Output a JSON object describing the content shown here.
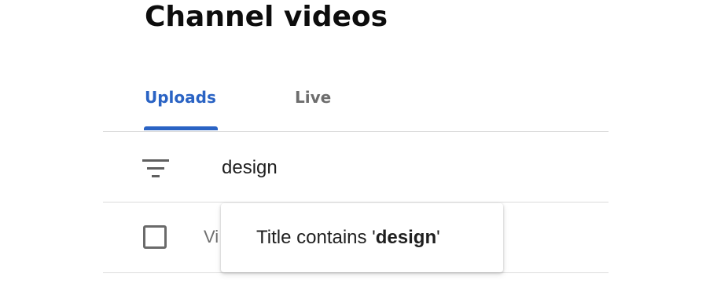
{
  "page": {
    "title": "Channel videos"
  },
  "tabs": [
    {
      "label": "Uploads",
      "selected": true
    },
    {
      "label": "Live",
      "selected": false
    }
  ],
  "filter": {
    "icon": "filter-icon",
    "value": "design"
  },
  "table": {
    "header_partial": "Vi"
  },
  "suggestion": {
    "prefix": "Title contains '",
    "term": "design",
    "suffix": "'"
  },
  "colors": {
    "accent": "#2a63c4",
    "divider": "#dcdcdc",
    "title": "#0d0d0d",
    "muted": "#6d6d6d"
  }
}
